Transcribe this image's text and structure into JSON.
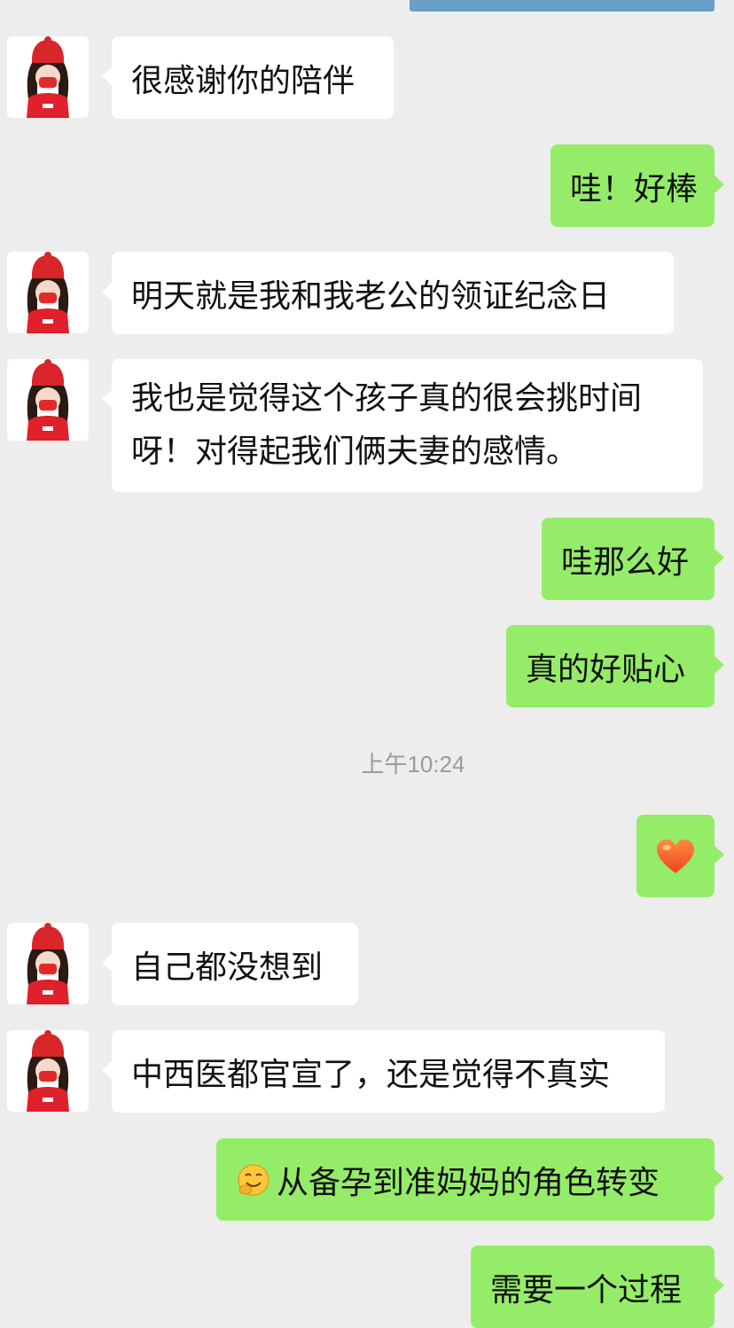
{
  "messages": [
    {
      "side": "in",
      "text": "很感谢你的陪伴"
    },
    {
      "side": "out",
      "text": "哇！好棒"
    },
    {
      "side": "in",
      "text": "明天就是我和我老公的领证纪念日"
    },
    {
      "side": "in",
      "line1": "我也是觉得这个孩子真的很会挑时间",
      "line2": "呀！对得起我们俩夫妻的感情。"
    },
    {
      "side": "out",
      "text": "哇那么好"
    },
    {
      "side": "out",
      "text": "真的好贴心"
    },
    {
      "side": "out",
      "emoji": "orange-heart"
    },
    {
      "side": "in",
      "text": "自己都没想到"
    },
    {
      "side": "in",
      "text": "中西医都官宣了，还是觉得不真实"
    },
    {
      "side": "out",
      "emoji": "grinning-face-with-hand",
      "text": "从备孕到准妈妈的角色转变"
    },
    {
      "side": "out",
      "text": "需要一个过程"
    }
  ],
  "timestamp": "上午10:24",
  "colors": {
    "background": "#ededed",
    "incoming_bubble": "#ffffff",
    "outgoing_bubble": "#95ec69",
    "avatar_red": "#e0202a"
  },
  "icons": {
    "avatar": "girl-in-red-hat-avatar",
    "heart": "orange-heart-emoji",
    "face": "grinning-face-emoji"
  }
}
